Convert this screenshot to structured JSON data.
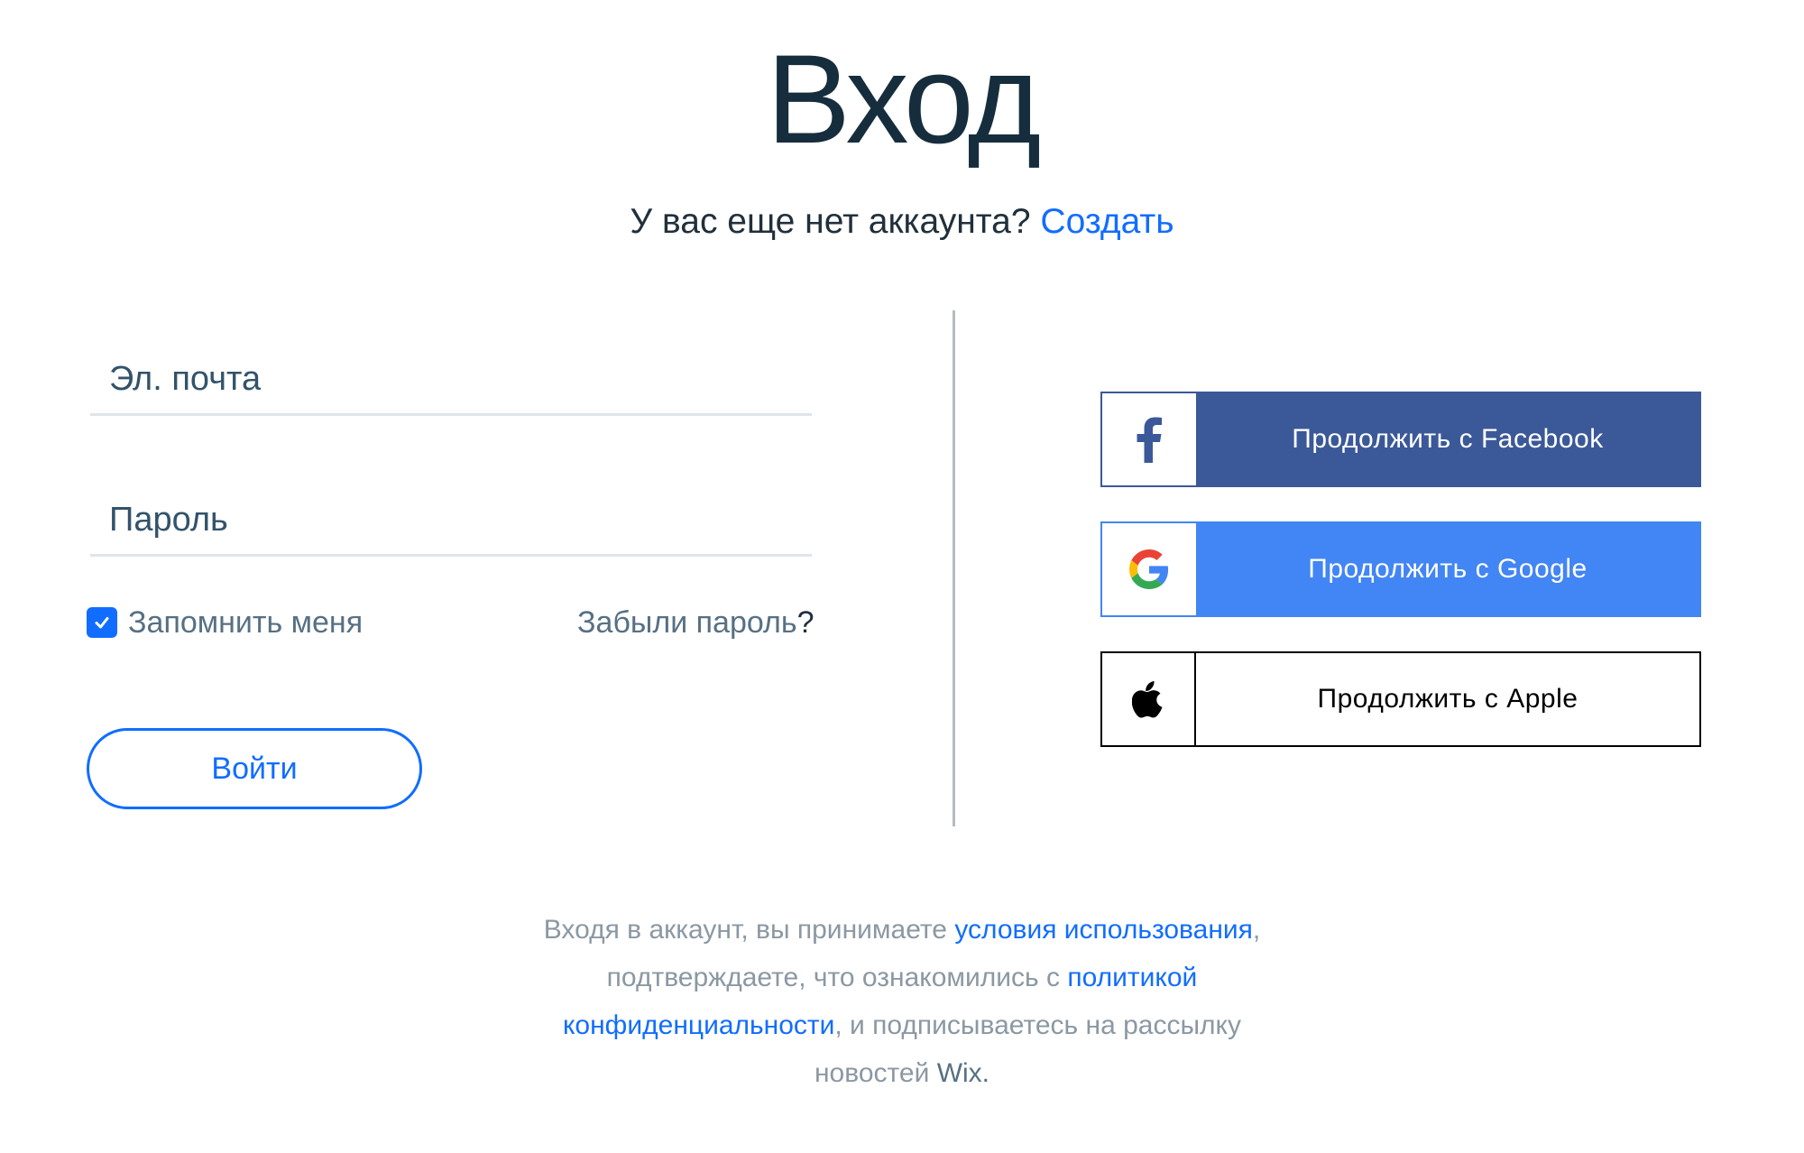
{
  "page": {
    "title": "Вход",
    "subtitle_text": "У вас еще нет аккаунта?",
    "subtitle_link": "Создать"
  },
  "form": {
    "email_placeholder": "Эл. почта",
    "password_placeholder": "Пароль",
    "remember_label": "Запомнить меня",
    "remember_checked": true,
    "forgot_text": "Забыли пароль",
    "forgot_q": "?",
    "login_label": "Войти"
  },
  "social": {
    "facebook_label": "Продолжить с Facebook",
    "google_label": "Продолжить с Google",
    "apple_label": "Продолжить с Apple"
  },
  "terms": {
    "part1": "Входя в аккаунт, вы принимаете ",
    "link1": "условия использования",
    "part2": ", подтверждаете, что ознакомились с ",
    "link2": "политикой конфиденциальности",
    "part3": ", и подписываетесь на рассылку новостей ",
    "brand": "Wix",
    "part4": "."
  },
  "colors": {
    "accent": "#116dff",
    "heading": "#162d3d",
    "facebook": "#3b5998",
    "google": "#4285f4",
    "muted": "#8b98a3"
  },
  "icons": [
    "facebook-icon",
    "google-icon",
    "apple-icon",
    "checkmark-icon"
  ]
}
